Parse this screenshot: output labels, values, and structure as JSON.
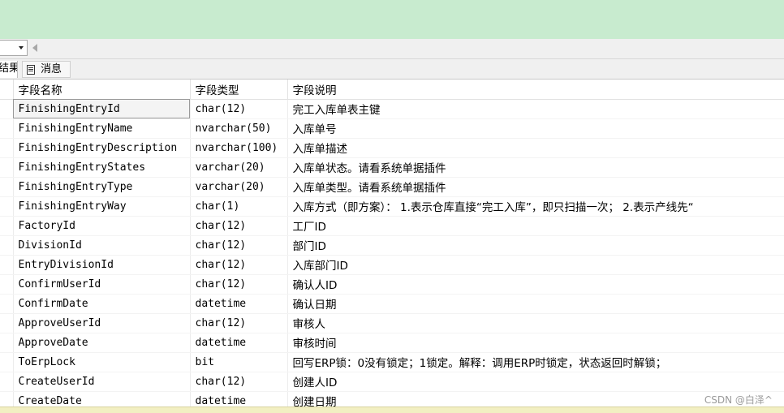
{
  "tabs": {
    "results_label": "结果",
    "messages_label": "消息"
  },
  "grid": {
    "columns": [
      "字段名称",
      "字段类型",
      "字段说明"
    ],
    "rows": [
      [
        "FinishingEntryId",
        "char(12)",
        "完工入库单表主键"
      ],
      [
        "FinishingEntryName",
        "nvarchar(50)",
        "入库单号"
      ],
      [
        "FinishingEntryDescription",
        "nvarchar(100)",
        "入库单描述"
      ],
      [
        "FinishingEntryStates",
        "varchar(20)",
        "入库单状态。请看系统单据插件"
      ],
      [
        "FinishingEntryType",
        "varchar(20)",
        "入库单类型。请看系统单据插件"
      ],
      [
        "FinishingEntryWay",
        "char(1)",
        "入库方式（即方案）：  1.表示仓库直接“完工入库”，即只扫描一次；  2.表示产线先“"
      ],
      [
        "FactoryId",
        "char(12)",
        "工厂ID"
      ],
      [
        "DivisionId",
        "char(12)",
        "部门ID"
      ],
      [
        "EntryDivisionId",
        "char(12)",
        "入库部门ID"
      ],
      [
        "ConfirmUserId",
        "char(12)",
        "确认人ID"
      ],
      [
        "ConfirmDate",
        "datetime",
        "确认日期"
      ],
      [
        "ApproveUserId",
        "char(12)",
        "审核人"
      ],
      [
        "ApproveDate",
        "datetime",
        "审核时间"
      ],
      [
        "ToErpLock",
        "bit",
        "回写ERP锁：0没有锁定；1锁定。解释：调用ERP时锁定，状态返回时解锁；"
      ],
      [
        "CreateUserId",
        "char(12)",
        "创建人ID"
      ],
      [
        "CreateDate",
        "datetime",
        "创建日期"
      ]
    ]
  },
  "watermark": "CSDN @白泽^"
}
